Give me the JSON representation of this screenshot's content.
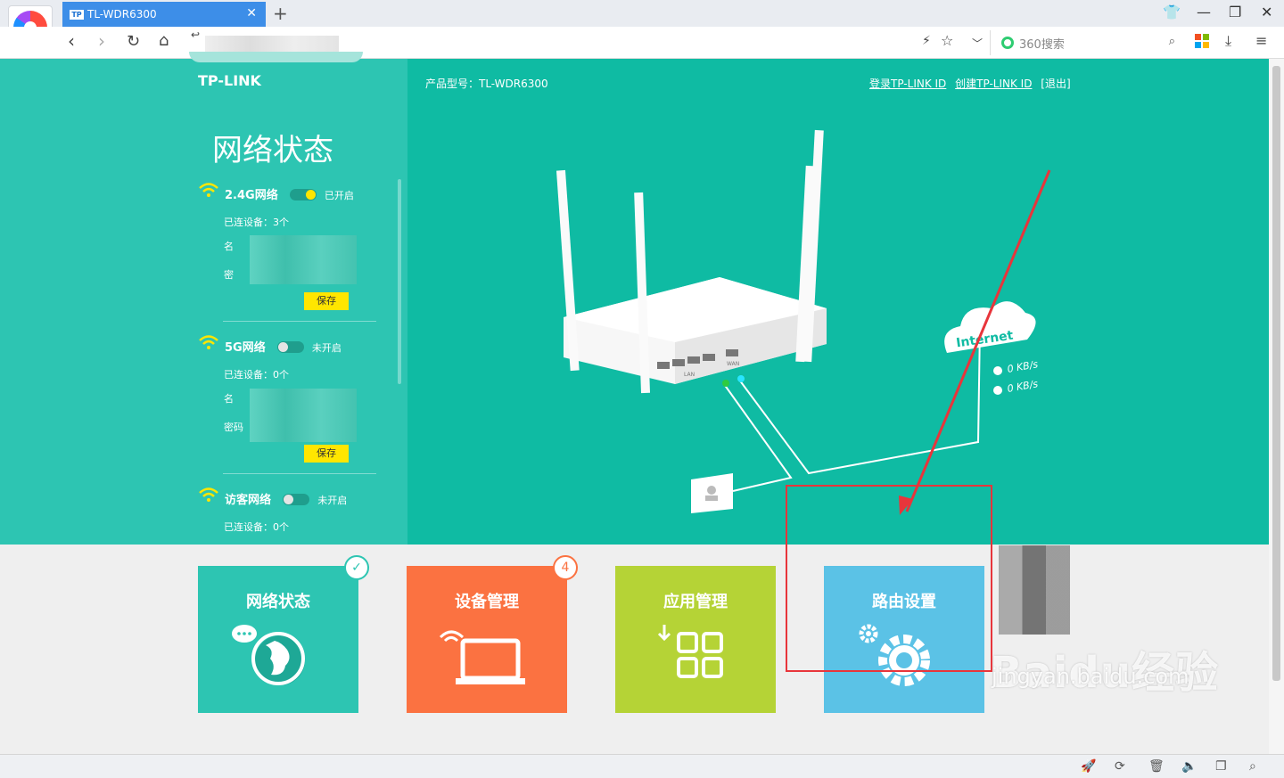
{
  "browser": {
    "tab_title": "TL-WDR6300",
    "tab_favicon": "TP",
    "search_placeholder": "360搜索"
  },
  "page": {
    "brand": "TP-LINK",
    "sidebar_title": "网络状态",
    "model_label": "产品型号：TL-WDR6300",
    "links": {
      "login": "登录TP-LINK ID",
      "create": "创建TP-LINK ID",
      "logout": "[退出]"
    },
    "networks": [
      {
        "name": "2.4G网络",
        "state": "已开启",
        "devices": "已连设备：3个",
        "name_label": "名",
        "pwd_label": "密",
        "save": "保存"
      },
      {
        "name": "5G网络",
        "state": "未开启",
        "devices": "已连设备：0个",
        "name_label": "名",
        "pwd_label": "密码",
        "save": "保存"
      },
      {
        "name": "访客网络",
        "state": "未开启",
        "devices": "已连设备：0个"
      }
    ],
    "diagram": {
      "internet_label": "Internet",
      "upload": "0 KB/s",
      "download": "0 KB/s",
      "lan": "LAN",
      "wan": "WAN"
    },
    "tiles": [
      {
        "label": "网络状态",
        "color": "#2dc5b2",
        "badge": "✓"
      },
      {
        "label": "设备管理",
        "color": "#fb7241",
        "badge": "4"
      },
      {
        "label": "应用管理",
        "color": "#b5d336"
      },
      {
        "label": "路由设置",
        "color": "#5bc2e6"
      }
    ],
    "watermark": "Baidu经验",
    "watermark_url": "jingyan.baidu.com"
  }
}
